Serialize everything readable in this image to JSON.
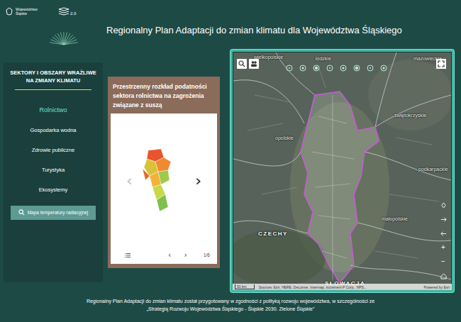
{
  "header": {
    "org": "Województwo Śląskie",
    "version": "2.0",
    "title": "Regionalny Plan Adaptacji do zmian klimatu dla Województwa Śląskiego"
  },
  "sidebar": {
    "title": "SEKTORY I OBSZARY WRAŻLIWE NA ZMIANY KLIMATU",
    "items": [
      {
        "label": "Rolnictwo",
        "selected": true
      },
      {
        "label": "Gospodarka wodna",
        "selected": false
      },
      {
        "label": "Zdrowie publiczne",
        "selected": false
      },
      {
        "label": "Turystyka",
        "selected": false
      },
      {
        "label": "Ekosystemy",
        "selected": false
      }
    ],
    "button": "Mapa temperatury radiacyjnej"
  },
  "card": {
    "title": "Przestrzenny rozkład podatności sektora rolnictwa na zagrożenia związane z suszą",
    "prev": "‹",
    "next": "›",
    "pager_prev": "‹",
    "pager_next": "›",
    "count": "1/6"
  },
  "map": {
    "labels": [
      {
        "text": "wielkopolskie",
        "kind": "region"
      },
      {
        "text": "łódzkie",
        "kind": "region"
      },
      {
        "text": "mazowieckie",
        "kind": "region"
      },
      {
        "text": "świętokrzyskie",
        "kind": "region"
      },
      {
        "text": "opolskie",
        "kind": "region"
      },
      {
        "text": "podkarpackie",
        "kind": "region"
      },
      {
        "text": "małopolskie",
        "kind": "region"
      },
      {
        "text": "CZECHY",
        "kind": "country"
      },
      {
        "text": "SŁOWACJA",
        "kind": "country"
      }
    ],
    "scale": "50 km",
    "attribution": "Sources: Esri, HERE, DeLorme, Intermap, increment P Corp., NPS...",
    "powered": "Powered by Esri",
    "zoom_in": "+",
    "zoom_out": "−"
  },
  "footer": "Regionalny Plan Adaptacji do zmian klimatu został przygotowany w zgodności z polityką rozwoju województwa, w szczególności ze „Strategią Rozwoju Województwa Śląskiego - Śląskie 2030. Zielone Śląskie”"
}
